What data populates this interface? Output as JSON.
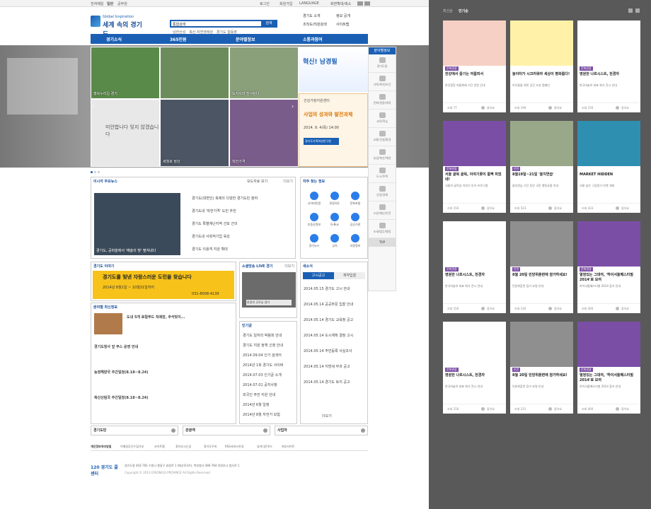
{
  "topbar": {
    "links": [
      "전자메일",
      "일반",
      "공무원"
    ],
    "right": [
      "로그인",
      "회원가입",
      "LANGUAGE",
      "화면확대/축소"
    ]
  },
  "logo": {
    "sub": "Global Inspiration",
    "main": "세계 속의 경기도"
  },
  "search": {
    "category": "통합검색",
    "button": "검색",
    "hot": [
      "남한산성",
      "축산·자연생태원",
      "경기도 합동장"
    ]
  },
  "quick": [
    "경기도 소개",
    "정보 공개",
    "조직도/직원검색",
    "사이트맵"
  ],
  "gnb": [
    "경기소식",
    "365민원",
    "분야별정보",
    "소통과참여"
  ],
  "visual": {
    "tiles": [
      "행복누리길 경기",
      "미안합니다 잊지 않겠습니다",
      "세월호 정산",
      "도지사와 천사된다",
      "환경과 기부",
      "착한가격"
    ],
    "ad": {
      "title": "혁신! 남경필",
      "sub": "건강가정지원센터",
      "headline": "사업의 성과와 발전과제",
      "date": "2014. 9. 4(목) 14:00",
      "org": "경기도가족여성연구원"
    }
  },
  "side": {
    "head": "분야별정보",
    "items": [
      "경기도청",
      "가족/복지/보건",
      "문화/관광/체육",
      "교육/학습",
      "교통/건설/환경",
      "농업/축산/해양",
      "도시/주택",
      "산업/경제",
      "소방/재난/안전",
      "조세/법무/행정"
    ],
    "top": "TOP"
  },
  "news": {
    "title": "이시각 주요뉴스",
    "tab2": "보도자료 보기",
    "more": "더보기",
    "caption": "경기도, 공마을에서 '예술의 빛' 펼쳐내다",
    "items": [
      "경기도(대변인) 축제의 다양한 경기도민 참여",
      "경기도내 '착한가격' 도민 추천",
      "경기도 특별재난지역 선포 건의",
      "경기도내 사회적기업 육성",
      "경기도 이용객 지원 확대"
    ]
  },
  "freq": {
    "title": "자주 찾는 정보",
    "items": [
      "사이버민원",
      "관광지도",
      "문화포털",
      "부동산정보",
      "G-Bus",
      "공공기관",
      "경기뉴스",
      "공지",
      "지원정보"
    ]
  },
  "story": {
    "title": "경기도 이야기",
    "banner": "경기도를 빛낸 자랑스러운 도민을 찾습니다",
    "period": "2014년 8월1일 ~ 10월31일까지",
    "phone": "031-8008-4139"
  },
  "latest": {
    "title": "분야별 최신정보",
    "items": [
      "도내 5개 로컬푸드 직매장, 추석맞이...",
      "경기도청사 앞 부스 운영 안내",
      "농정해양국 주간일정(8.18~8.24)",
      "축산산림국 주간일정(8.18~8.24)"
    ]
  },
  "sns": {
    "title": "소셜방송 LIVE 경기",
    "caption": "한경의 굿모닝 경기",
    "more": "더보기"
  },
  "keyword": {
    "title": "인기글",
    "items": [
      "경기도 일자리 박람회 안내",
      "경기도 지원 정책 신청 안내",
      "2014.09.04 인기 검색어",
      "2014년 1회 경기도 사이버",
      "2014.07.03 인기글 소개",
      "2014.07.01 공지사항",
      "외국인 주민 지원 안내",
      "2014년 6월 일정",
      "2014년 8월 자전거 보험"
    ]
  },
  "notice": {
    "title": "새소식",
    "tabs": [
      "고시공고",
      "계약입찰"
    ],
    "more": "더보기",
    "items": [
      "2014.05.15 경기도 고시 안내",
      "2014.05.14 공공부문 입찰 안내",
      "2014.05.14 경기도 교육청 공고",
      "2014.05.14 도시계획 결정 고시",
      "2014.05.14 주민등록 사실조사",
      "2014.05.14 지방세 부과 공고",
      "2014.05.14 경기도 토지 공고"
    ]
  },
  "selects": [
    "경기도민",
    "관광객",
    "사업자"
  ],
  "footer": {
    "links": [
      "개인정보처리방침",
      "이메일무단수집거부",
      "사이트맵",
      "찾아오시는길",
      "찾기도우미",
      "RSS서비스안내",
      "뷰어다운로드",
      "외부사이트"
    ],
    "address": "경기도청 442-781 수원시 팔달구 효원로 1 (매산로3가), 북부청사 480-784 의정부시 청사로 1",
    "copy": "Copyright © 2013 GYEONGGI PROVINCE All Rights Reserved.",
    "callcenter": "120 경기도 콜센터"
  },
  "panel": {
    "tabs": [
      "최신순",
      "인기순"
    ],
    "cards": [
      {
        "title": "한강에서 즐기는 여름피서",
        "desc": "한강몽땅 여름축제 기간 연장 안내",
        "tag": "문화관광",
        "views": "조회 77",
        "like": "좋아요"
      },
      {
        "title": "놀이터가 시끄러워야 세상이 평화롭다!",
        "desc": "아이들을 위한 공간 조성 캠페인",
        "tag": "",
        "views": "조회 199",
        "like": "좋아요"
      },
      {
        "title": "영원한 나르시스트, 천경자",
        "desc": "한국미술의 대표 화가 전시 안내",
        "tag": "문화관광",
        "views": "조회 156",
        "like": "좋아요"
      },
      {
        "title": "서울 골목 골목, 이야기꽃이 활짝 피었네!",
        "desc": "서울의 골목길 이야기 투어 프로그램",
        "tag": "문화관광",
        "views": "조회 156",
        "like": "좋아요"
      },
      {
        "title": "8월19일~21일 '을지연습'",
        "desc": "을지연습 기간 동안 국민 행동요령 안내",
        "tag": "안전",
        "views": "조회 523",
        "like": "좋아요"
      },
      {
        "title": "MARKET HIDDEN",
        "desc": "서울 숨은 그림찾기 마켓 개최",
        "tag": "",
        "views": "조회 433",
        "like": "좋아요"
      },
      {
        "title": "영원한 나르시스트, 천경자",
        "desc": "한국미술의 대표 화가 전시 안내",
        "tag": "문화관광",
        "views": "조회 156",
        "like": "좋아요"
      },
      {
        "title": "8월 20일 민방위훈련에 참가하세요!",
        "desc": "민방위훈련 참가 요령 안내",
        "tag": "안전",
        "views": "조회 130",
        "like": "좋아요"
      },
      {
        "title": "열정있는 그대여, '하이서울페스티벌 2014'로 모여",
        "desc": "하이서울페스티벌 2014 참가 안내",
        "tag": "문화관광",
        "views": "조회 400",
        "like": "좋아요"
      },
      {
        "title": "영원한 나르시스트, 천경자",
        "desc": "한국미술의 대표 화가 전시 안내",
        "tag": "문화관광",
        "views": "조회 156",
        "like": "좋아요"
      },
      {
        "title": "8월 20일 민방위훈련에 참가하세요!",
        "desc": "민방위훈련 참가 요령 안내",
        "tag": "안전",
        "views": "조회 131",
        "like": "좋아요"
      },
      {
        "title": "열정있는 그대여, '하이서울페스티벌 2014'로 모여",
        "desc": "하이서울페스티벌 2014 참가 안내",
        "tag": "문화관광",
        "views": "조회 400",
        "like": "좋아요"
      }
    ]
  }
}
